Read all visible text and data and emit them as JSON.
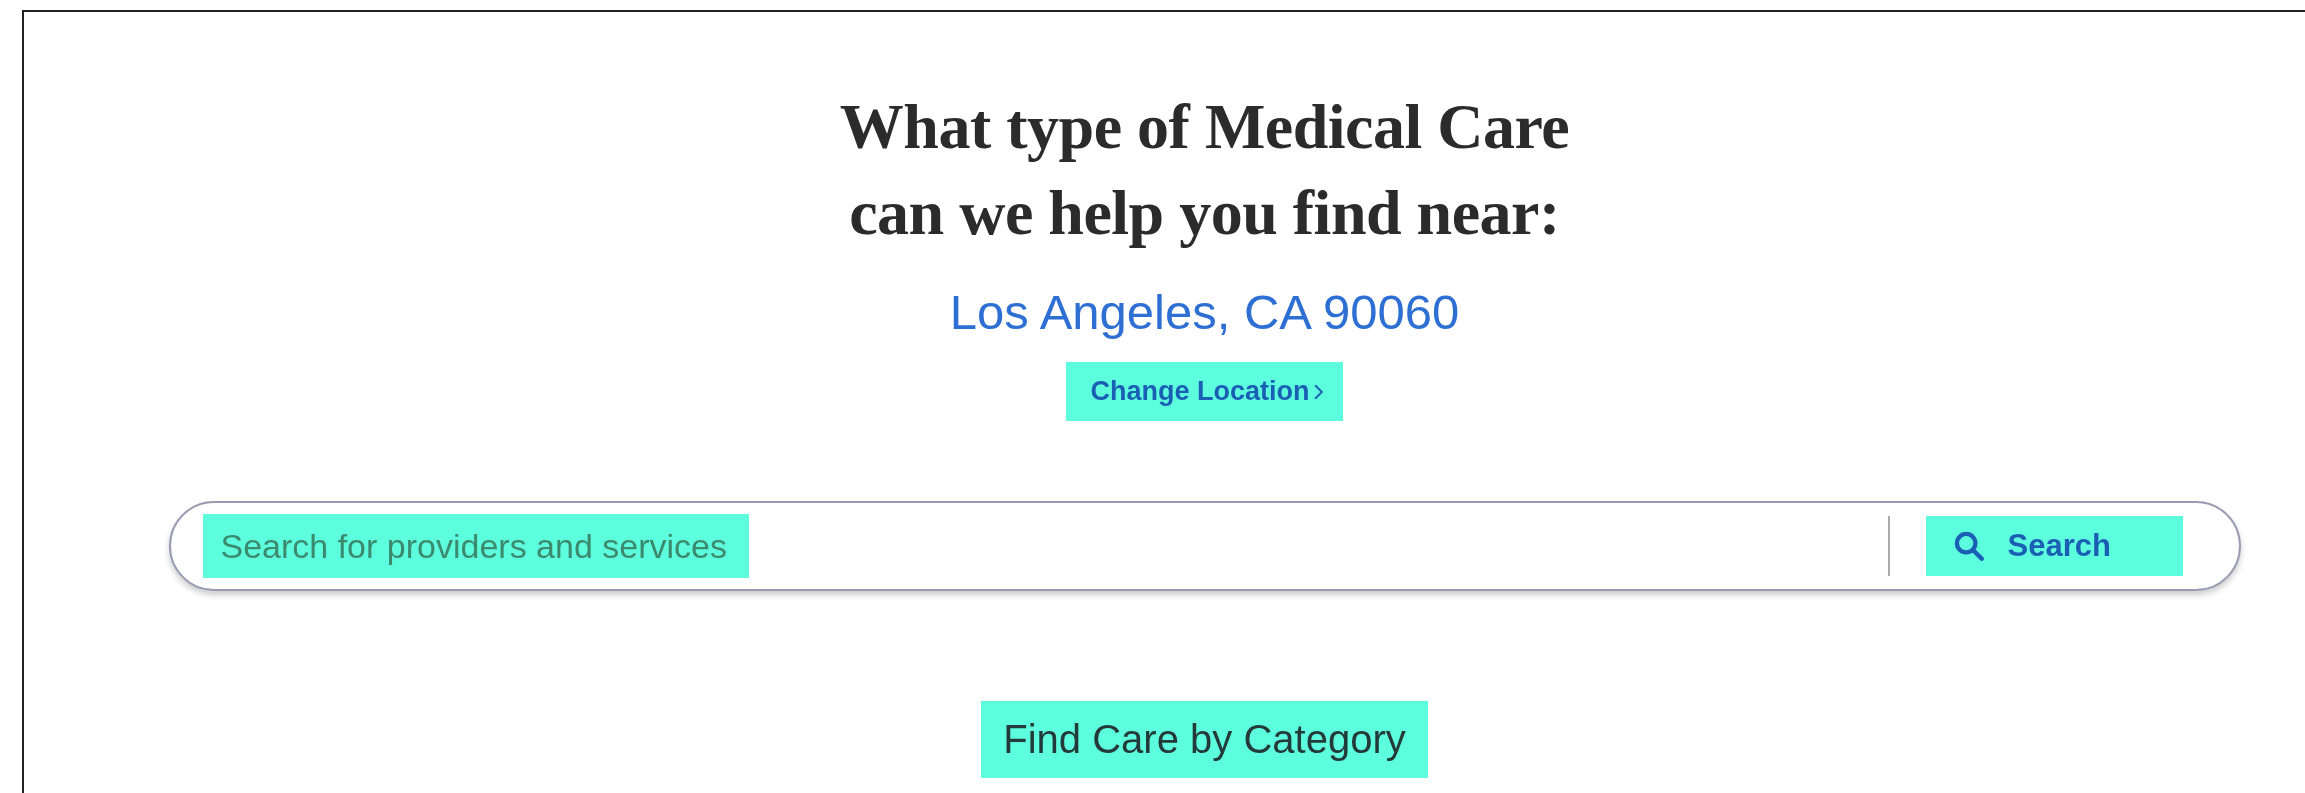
{
  "heading": {
    "lines": [
      "What type of Medical Care",
      "can we help you find near:"
    ]
  },
  "location": {
    "text": "Los Angeles, CA 90060",
    "change_link": "Change Location"
  },
  "search": {
    "placeholder": "Search for providers and services",
    "button": "Search"
  },
  "category_heading": "Find Care by Category"
}
